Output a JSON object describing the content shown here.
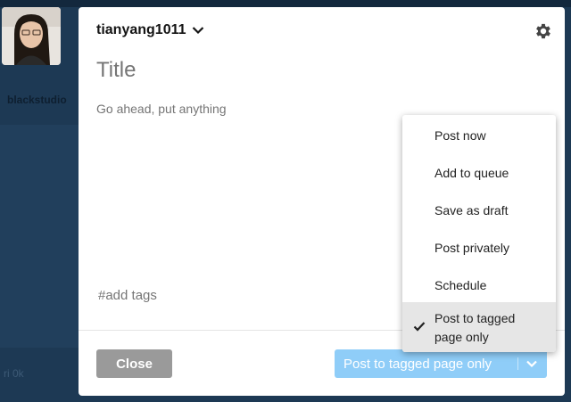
{
  "background": {
    "left_text": "blackstudio",
    "bottom_text": "ri 0k"
  },
  "composer": {
    "account_name": "tianyang1011",
    "title_placeholder": "Title",
    "body_placeholder": "Go ahead, put anything",
    "tags_placeholder": "#add tags",
    "close_label": "Close",
    "post_label": "Post to tagged page only"
  },
  "post_menu": {
    "items": [
      {
        "label": "Post now",
        "selected": false
      },
      {
        "label": "Add to queue",
        "selected": false
      },
      {
        "label": "Save as draft",
        "selected": false
      },
      {
        "label": "Post privately",
        "selected": false
      },
      {
        "label": "Schedule",
        "selected": false
      },
      {
        "label": "Post to tagged page only",
        "selected": true
      }
    ]
  },
  "colors": {
    "overlay": "#1d3954",
    "post_button": "#8fcdf8",
    "close_button": "#9a9a9a",
    "selected_item": "#e6e6e6"
  },
  "icons": [
    "chevron-down-icon",
    "gear-icon",
    "checkmark-icon"
  ]
}
